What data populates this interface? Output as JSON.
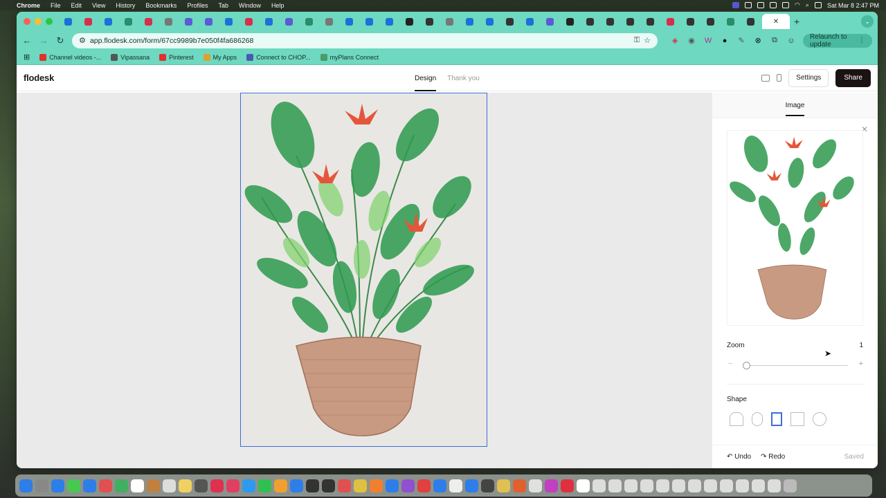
{
  "menubar": {
    "app": "Chrome",
    "items": [
      "File",
      "Edit",
      "View",
      "History",
      "Bookmarks",
      "Profiles",
      "Tab",
      "Window",
      "Help"
    ],
    "clock": "Sat Mar 8  2:47 PM"
  },
  "browser": {
    "url": "app.flodesk.com/form/67cc9989b7e050f4fa686268",
    "relaunch_label": "Relaunch to update",
    "bookmarks": [
      "Channel videos -...",
      "Vipassana",
      "Pinterest",
      "My Apps",
      "Connect to CHOP...",
      "myPlans Connect"
    ],
    "tab_icon_colors": [
      "#1f6fd8",
      "#d62e4d",
      "#1f6fd8",
      "#2a8c6a",
      "#d62e4d",
      "#777",
      "#5b5bd6",
      "#5b5bd6",
      "#1f6fd8",
      "#d62e4d",
      "#1f6fd8",
      "#5b5bd6",
      "#2a8c6a",
      "#777",
      "#1f6fd8",
      "#1f6fd8",
      "#1f6fd8",
      "#222",
      "#333",
      "#777",
      "#1f6fd8",
      "#1f6fd8",
      "#333",
      "#1f6fd8",
      "#5b5bd6",
      "#222",
      "#333",
      "#333",
      "#333",
      "#333",
      "#d62e4d",
      "#333",
      "#333",
      "#2a8c6a",
      "#333",
      "#333",
      "#333"
    ],
    "bookmark_colors": [
      "#e03030",
      "#555",
      "#e03030",
      "#e0a030",
      "#4a5ab0",
      "#4a9a6a"
    ]
  },
  "app": {
    "logo": "flodesk",
    "tabs": [
      "Design",
      "Thank you"
    ],
    "settings_label": "Settings",
    "share_label": "Share"
  },
  "sidebar": {
    "tab": "Image",
    "zoom_label": "Zoom",
    "zoom_value": "1",
    "zoom_level": 0,
    "shape_label": "Shape",
    "shapes": [
      "arch",
      "pill",
      "rectangle",
      "square",
      "circle"
    ],
    "selected_shape": "rectangle",
    "undo_label": "Undo",
    "redo_label": "Redo",
    "status": "Saved"
  },
  "colors": {
    "accent_selection": "#3a6fd8",
    "share_button": "#1b1212",
    "browser_theme": "#6ed8c0"
  }
}
